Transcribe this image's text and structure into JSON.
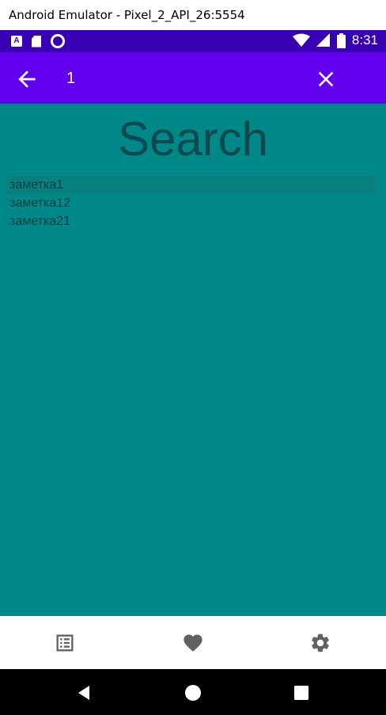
{
  "window": {
    "title": "Android Emulator - Pixel_2_API_26:5554"
  },
  "status_bar": {
    "time": "8:31"
  },
  "toolbar": {
    "search_value": "1"
  },
  "page": {
    "title": "Search"
  },
  "results": [
    {
      "label": "заметка1"
    },
    {
      "label": "заметка12"
    },
    {
      "label": "заметка21"
    }
  ],
  "bottom_nav": {
    "items": [
      {
        "icon": "list-icon"
      },
      {
        "icon": "heart-icon"
      },
      {
        "icon": "gear-icon"
      }
    ]
  },
  "colors": {
    "status_bar": "#3700b3",
    "app_bar": "#6200ee",
    "background": "#008888",
    "text": "#0b4a4e"
  }
}
